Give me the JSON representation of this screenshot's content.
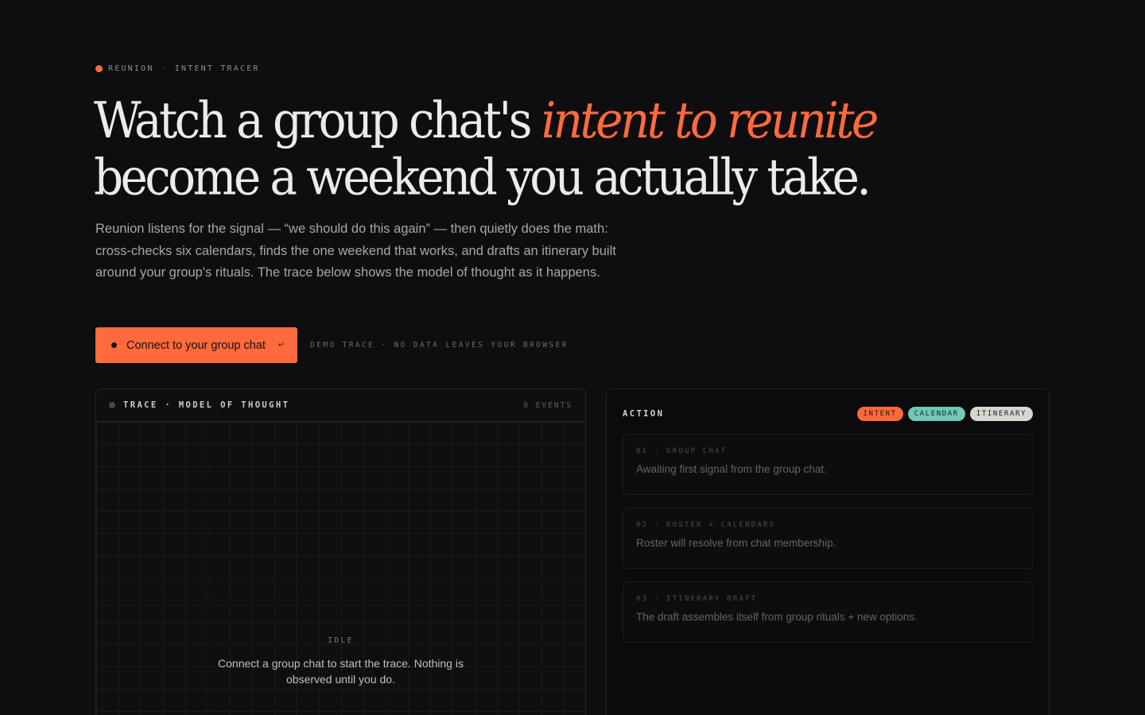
{
  "eyebrow": {
    "brand": "REUNION",
    "separator": "·",
    "product": "INTENT TRACER"
  },
  "headline": {
    "line1_plain": "Watch a group chat's ",
    "line1_accent": "intent to reunite",
    "line2": "become a weekend you actually take."
  },
  "lede": "Reunion listens for the signal — “we should do this again” — then quietly does the math: cross-checks six calendars, finds the one weekend that works, and drafts an itinerary built around your group's rituals. The trace below shows the model of thought as it happens.",
  "cta": {
    "label": "Connect to your group chat",
    "return_glyph": "↵"
  },
  "demo_note": "DEMO TRACE · NO DATA LEAVES YOUR BROWSER",
  "trace": {
    "title": "TRACE · MODEL OF THOUGHT",
    "event_count": "0 EVENTS",
    "idle_label": "IDLE",
    "idle_message": "Connect a group chat to start the trace. Nothing is observed until you do."
  },
  "action": {
    "title": "ACTION",
    "badges": [
      "INTENT",
      "CALENDAR",
      "ITINERARY"
    ],
    "steps": [
      {
        "tag": "01 · GROUP CHAT",
        "description": "Awaiting first signal from the group chat."
      },
      {
        "tag": "02 · ROSTER × CALENDARS",
        "description": "Roster will resolve from chat membership."
      },
      {
        "tag": "03 · ITINERARY DRAFT",
        "description": "The draft assembles itself from group rituals + new options."
      }
    ]
  },
  "colors": {
    "accent": "#ff6a3d",
    "calendar": "#6fc9b5",
    "itinerary": "#d9d6d1",
    "background": "#0e0e10"
  }
}
